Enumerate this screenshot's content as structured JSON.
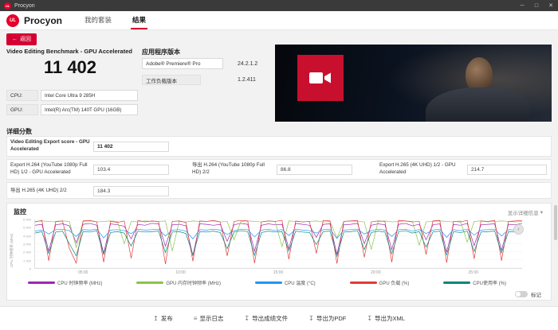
{
  "brand": {
    "logo_text": "UL",
    "name": "Procyon"
  },
  "titlebar": {
    "title": "Procyon",
    "min": "─",
    "max": "□",
    "close": "✕"
  },
  "header": {
    "tabs": [
      {
        "label": "我的套装"
      },
      {
        "label": "结果"
      }
    ]
  },
  "back": {
    "arrow": "←",
    "label": "返回"
  },
  "result": {
    "benchmark_title": "Video Editing Benchmark - GPU Accelerated",
    "score": "11 402",
    "cpu_label": "CPU:",
    "cpu_value": "Intel Core Ultra 9 285H",
    "gpu_label": "GPU:",
    "gpu_value": "Intel(R) Arc(TM) 140T GPU (16GB)",
    "app_version_title": "应用程序版本",
    "app_name": "Adobe® Premiere® Pro",
    "app_version": "24.2.1.2",
    "workload_label": "工作负载版本",
    "workload_version": "1.2.411"
  },
  "details": {
    "title": "详细分数",
    "rows": [
      {
        "label": "Video Editing Export score - GPU Accelerated",
        "value": "11 402"
      },
      {
        "label": "Export H.264 (YouTube 1080p Full HD) 1/2 - GPU Accelerated",
        "value": "103.4"
      },
      {
        "label": "导出 H.264 (YouTube 1080p Full HD) 2/2",
        "value": "86.8"
      },
      {
        "label": "Export H.265 (4K UHD) 1/2 - GPU Accelerated",
        "value": "214.7"
      },
      {
        "label": "导出 H.265 (4K UHD) 2/2",
        "value": "184.3"
      }
    ]
  },
  "monitoring": {
    "title": "监控",
    "details_link": "显示详细信息",
    "details_chevron": "▾",
    "pan_glyph": "‹",
    "mark_label": "标记",
    "y_axis_label": "CPU 时钟频率 (MHz)"
  },
  "chart_data": {
    "type": "line",
    "title": "监控",
    "xlabel": "",
    "ylabel": "CPU 时钟频率 (MHz)",
    "grid": true,
    "legend_position": "bottom",
    "x_ticks": [
      "05:00",
      "10:00",
      "15:00",
      "20:00",
      "25:00"
    ],
    "y_ticks": [
      "6 000",
      "5 000",
      "4 000",
      "3 000",
      "2 000",
      "1 000",
      "0"
    ],
    "series": [
      {
        "name": "CPU 时钟频率 (MHz)",
        "color": "#9c27b0",
        "values": [
          88,
          90,
          35,
          89,
          91,
          87,
          52,
          90,
          92,
          88,
          30,
          91,
          89,
          86,
          60,
          90,
          88,
          92,
          91,
          45,
          89,
          90,
          87,
          25,
          91,
          90,
          88,
          90,
          55,
          89,
          92,
          90,
          35,
          88,
          91,
          89,
          90,
          40,
          92,
          90,
          88,
          63,
          90,
          91,
          28,
          89,
          90,
          92,
          50,
          88,
          91,
          89,
          38,
          90,
          92,
          87,
          90,
          58,
          89,
          91,
          33,
          90,
          88,
          92,
          46,
          89,
          90,
          91,
          36,
          90,
          89,
          92
        ]
      },
      {
        "name": "GPU 内存时钟频率 (MHz)",
        "color": "#8bc34a",
        "values": [
          96,
          97,
          96,
          95,
          97,
          96,
          42,
          96,
          97,
          95,
          96,
          97,
          96,
          50,
          96,
          95,
          97,
          96,
          96,
          97,
          35,
          96,
          95,
          97,
          96,
          96,
          97,
          95,
          96,
          58,
          96,
          97,
          96,
          95,
          97,
          96,
          44,
          97,
          96,
          95,
          96,
          97,
          95,
          96,
          62,
          96,
          97,
          96,
          95,
          38,
          96,
          97,
          95,
          96,
          97,
          96,
          47,
          95,
          96,
          97,
          96,
          95,
          97,
          53,
          96,
          97,
          95,
          96,
          97,
          96,
          95,
          96
        ]
      },
      {
        "name": "CPU 温度 (°C)",
        "color": "#2196f3",
        "values": [
          76,
          78,
          70,
          79,
          80,
          77,
          65,
          79,
          78,
          80,
          62,
          78,
          79,
          77,
          71,
          80,
          78,
          79,
          80,
          66,
          78,
          79,
          76,
          60,
          79,
          78,
          80,
          78,
          69,
          77,
          80,
          79,
          64,
          78,
          80,
          77,
          79,
          67,
          80,
          78,
          77,
          72,
          79,
          80,
          61,
          78,
          79,
          80,
          70,
          77,
          80,
          78,
          65,
          79,
          80,
          76,
          79,
          71,
          78,
          80,
          63,
          79,
          77,
          80,
          68,
          78,
          79,
          80,
          66,
          79,
          78,
          80
        ]
      },
      {
        "name": "GPU 负载 (%)",
        "color": "#e53935",
        "values": [
          95,
          98,
          15,
          96,
          97,
          40,
          10,
          97,
          98,
          95,
          12,
          96,
          94,
          97,
          20,
          98,
          95,
          97,
          96,
          8,
          96,
          97,
          94,
          14,
          97,
          96,
          98,
          95,
          25,
          96,
          98,
          97,
          10,
          95,
          97,
          96,
          98,
          18,
          97,
          95,
          96,
          30,
          98,
          97,
          9,
          96,
          97,
          98,
          22,
          95,
          97,
          96,
          12,
          98,
          97,
          95,
          96,
          28,
          97,
          98,
          11,
          96,
          95,
          98,
          19,
          97,
          96,
          98,
          15,
          96,
          97,
          98
        ]
      },
      {
        "name": "CPU使用率 (%)",
        "color": "#00897b",
        "values": [
          72,
          75,
          30,
          74,
          76,
          50,
          25,
          75,
          74,
          77,
          28,
          73,
          75,
          72,
          45,
          76,
          74,
          75,
          76,
          32,
          74,
          75,
          71,
          27,
          75,
          74,
          76,
          73,
          40,
          74,
          77,
          75,
          26,
          73,
          76,
          74,
          75,
          35,
          76,
          74,
          73,
          48,
          75,
          76,
          24,
          74,
          75,
          77,
          38,
          73,
          76,
          74,
          29,
          75,
          77,
          72,
          75,
          43,
          74,
          76,
          27,
          75,
          73,
          76,
          34,
          74,
          75,
          76,
          31,
          75,
          74,
          77
        ]
      }
    ]
  },
  "footer": {
    "items": [
      {
        "icon": "↥",
        "label": "发布"
      },
      {
        "icon": "≡",
        "label": "显示日志"
      },
      {
        "icon": "↧",
        "label": "导出成绩文件"
      },
      {
        "icon": "↧",
        "label": "导出为PDF"
      },
      {
        "icon": "↧",
        "label": "导出为XML"
      }
    ]
  }
}
